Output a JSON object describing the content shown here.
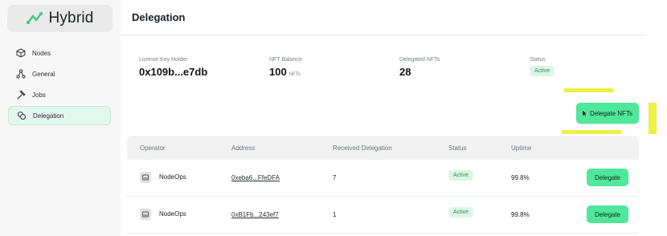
{
  "app": {
    "name": "Hybrid"
  },
  "nav": {
    "items": [
      {
        "label": "Nodes",
        "icon": "cube-icon"
      },
      {
        "label": "General",
        "icon": "network-icon"
      },
      {
        "label": "Jobs",
        "icon": "hammer-icon"
      },
      {
        "label": "Delegation",
        "icon": "coins-icon",
        "active": true
      }
    ]
  },
  "header": {
    "title": "Delegation"
  },
  "summary": {
    "license": {
      "label": "License Key Holder",
      "value": "0x109b...e7db"
    },
    "balance": {
      "label": "NFT Balance",
      "value": "100",
      "unit": "NFTs"
    },
    "delegated": {
      "label": "Delegated NFTs",
      "value": "28"
    },
    "status": {
      "label": "Status",
      "value": "Active"
    }
  },
  "actions": {
    "delegate_nfts": "Delegate NFTs"
  },
  "table": {
    "columns": [
      "Operator",
      "Address",
      "Received Delegation",
      "Status",
      "Uptime"
    ],
    "rows": [
      {
        "operator": "NodeOps",
        "address": "0xeba6...FfeDFA",
        "received": "7",
        "status": "Active",
        "uptime": "99.8%",
        "action": "Delegate"
      },
      {
        "operator": "NodeOps",
        "address": "0xB1Fb...243ef7",
        "received": "1",
        "status": "Active",
        "uptime": "99.8%",
        "action": "Delegate"
      }
    ]
  },
  "colors": {
    "accent": "#4fe89a",
    "highlight": "#ecf046",
    "active_badge": "#dcf5e6"
  }
}
